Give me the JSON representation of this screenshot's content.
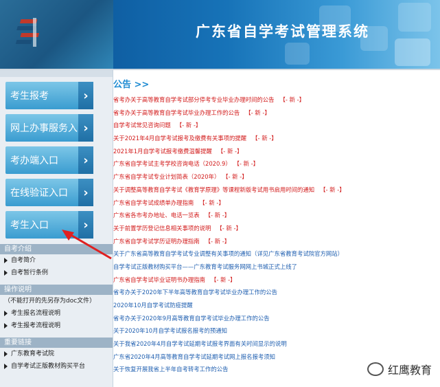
{
  "header": {
    "title": "广东省自学考试管理系统"
  },
  "sidebar": {
    "buttons": [
      {
        "label": "考生报考"
      },
      {
        "label": "网上办事服务入口"
      },
      {
        "label": "考办端入口"
      },
      {
        "label": "在线验证入口"
      },
      {
        "label": "考生入口"
      }
    ],
    "sections": [
      {
        "title": "自考介绍",
        "links": [
          "自考简介",
          "自考暂行条例"
        ]
      },
      {
        "title": "操作说明",
        "plain": "（不能打开的先另存为doc文件）",
        "links": [
          "考生报名流程说明",
          "考生报考流程说明"
        ]
      },
      {
        "title": "重要链接",
        "links": [
          "广东教育考试院",
          "自学考试正版教材购买平台"
        ]
      }
    ]
  },
  "main": {
    "notice_heading": "公告 >>",
    "new_tag": "【- 新 -】",
    "notices": [
      {
        "text": "省考办关于高等教育自学考试部分停考专业毕业办理时间的公告",
        "new": true,
        "color": "red"
      },
      {
        "text": "省考办关于高等教育自学考试毕业办理工作的公告",
        "new": true,
        "color": "red"
      },
      {
        "text": "自学考试常见咨询问题",
        "new": true,
        "color": "red"
      },
      {
        "text": "关于2021年4月自学考试报考及缴费有关事项的提醒",
        "new": true,
        "color": "red"
      },
      {
        "text": "2021年1月自学考试报考缴费温馨提醒",
        "new": true,
        "color": "red"
      },
      {
        "text": "广东省自学考试主考学校咨询电话（2020.9）",
        "new": true,
        "color": "red"
      },
      {
        "text": "广东省自学考试专业计划简表（2020年）",
        "new": true,
        "color": "red"
      },
      {
        "text": "关于调整高等教育自学考试《教育学原理》等课程新版考试用书启用时间的通知",
        "new": true,
        "color": "red"
      },
      {
        "text": "广东省自学考试成绩单办理指南",
        "new": true,
        "color": "red"
      },
      {
        "text": "广东省各市考办地址、电话一览表",
        "new": true,
        "color": "red"
      },
      {
        "text": "关于前置学历登记信息相关事项的说明",
        "new": true,
        "color": "red"
      },
      {
        "text": "广东省自学考试学历证明办理指南",
        "new": true,
        "color": "red"
      },
      {
        "text": "关于广东省高等教育自学考试专业调整有关事项的通知（详见广东省教育考试院官方网站）",
        "new": false,
        "color": "blue"
      },
      {
        "text": "自学考试正版教材购买平台——广东教育考试服务网网上书城正式上线了",
        "new": false,
        "color": "blue"
      },
      {
        "text": "广东省自学考试毕业证明书办理指南",
        "new": true,
        "color": "red"
      },
      {
        "text": "省考办关于2020年下半年高等教育自学考试毕业办理工作的公告",
        "new": false,
        "color": "blue"
      },
      {
        "text": "2020年10月自学考试防疫提醒",
        "new": false,
        "color": "blue"
      },
      {
        "text": "省考办关于2020年9月高等教育自学考试毕业办理工作的公告",
        "new": false,
        "color": "blue"
      },
      {
        "text": "关于2020年10月自学考试报名报考的预通知",
        "new": false,
        "color": "blue"
      },
      {
        "text": "关于我省2020年4月自学考试延期考试报考界面有关时间显示的说明",
        "new": false,
        "color": "blue"
      },
      {
        "text": "广东省2020年4月高等教育自学考试延期考试网上报名报考须知",
        "new": false,
        "color": "blue"
      },
      {
        "text": "关于恢复开展我省上半年自考转考工作的公告",
        "new": false,
        "color": "blue"
      }
    ]
  },
  "watermark": {
    "text": "红鹰教育"
  },
  "colors": {
    "accent": "#1e8bd2",
    "notice_red": "#d21a1a",
    "notice_blue": "#1f5fb0",
    "button": "#3a9cd0"
  }
}
